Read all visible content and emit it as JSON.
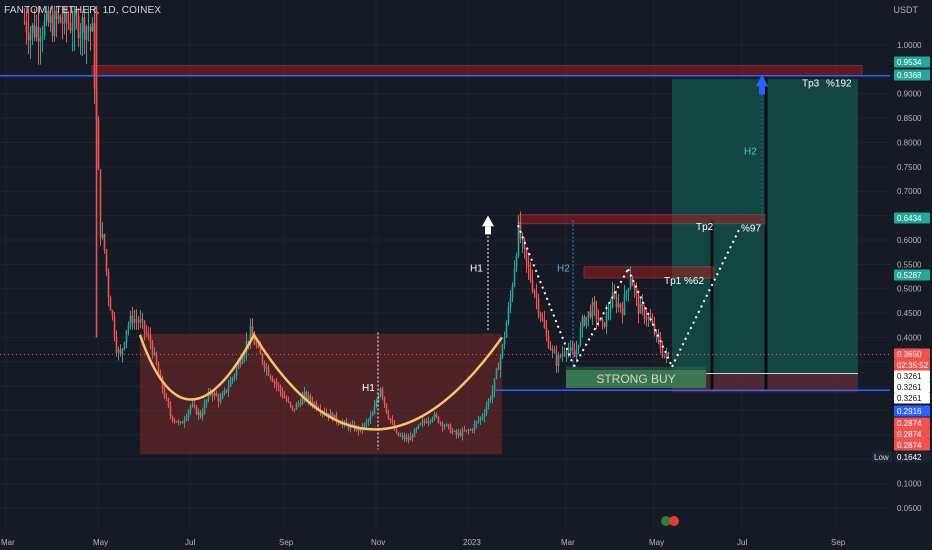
{
  "header": {
    "title": "FANTOM / TETHER, 1D, COINEX",
    "currency": "USDT"
  },
  "colors": {
    "background": "#161a25",
    "up": "#26a69a",
    "down": "#ef5350",
    "hline": "#2962ff",
    "resistance_fill": "#b71c1c",
    "cup_fill": "#7a2a2a",
    "cup_line": "#f5c46b",
    "target_fill": "#134d46"
  },
  "chart_data": {
    "type": "candlestick",
    "x_ticks": [
      "Mar",
      "May",
      "Jul",
      "Sep",
      "Nov",
      "2023",
      "Mar",
      "May",
      "Jul",
      "Sep"
    ],
    "y_ticks": [
      "1.0000",
      "0.9000",
      "0.8500",
      "0.8000",
      "0.7500",
      "0.7000",
      "0.6500",
      "0.6000",
      "0.5500",
      "0.5000",
      "0.4500",
      "0.4000",
      "0.1500",
      "0.1000",
      "0.0500"
    ],
    "y_scale": "linear",
    "ylim": [
      0.03,
      1.08
    ],
    "price_labels": [
      {
        "text": "0.9534",
        "kind": "green"
      },
      {
        "text": "0.9368",
        "kind": "green"
      },
      {
        "text": "0.6434",
        "kind": "green"
      },
      {
        "text": "0.5287",
        "kind": "green"
      },
      {
        "text": "0.3650",
        "kind": "red"
      },
      {
        "text": "02:35:52",
        "kind": "red"
      },
      {
        "text": "0.3261",
        "kind": "white"
      },
      {
        "text": "0.3261",
        "kind": "white"
      },
      {
        "text": "0.3261",
        "kind": "white"
      },
      {
        "text": "0.2916",
        "kind": "blue"
      },
      {
        "text": "0.2874",
        "kind": "red"
      },
      {
        "text": "0.2874",
        "kind": "red"
      },
      {
        "text": "0.2874",
        "kind": "red"
      },
      {
        "text": "0.1642",
        "kind": "dark"
      }
    ],
    "low_label": "Low",
    "annotations": {
      "h1_left": "H1",
      "h1_right": "H1",
      "h2_mid": "H2",
      "h2_right": "H2",
      "tp1": "Tp1 %62",
      "tp2": "Tp2",
      "tp2_pct": "%97",
      "tp3": "Tp3",
      "tp3_pct": "%192",
      "strong_buy": "STRONG BUY"
    },
    "levels": {
      "blue_top": 0.9368,
      "blue_bottom": 0.2916,
      "current": 0.365,
      "resistance_top": [
        0.9368,
        0.9534
      ],
      "resistance_tp2": [
        0.6334,
        0.6434
      ],
      "resistance_tp1": [
        0.5187,
        0.5387
      ],
      "cup_rim": 0.4075
    }
  }
}
